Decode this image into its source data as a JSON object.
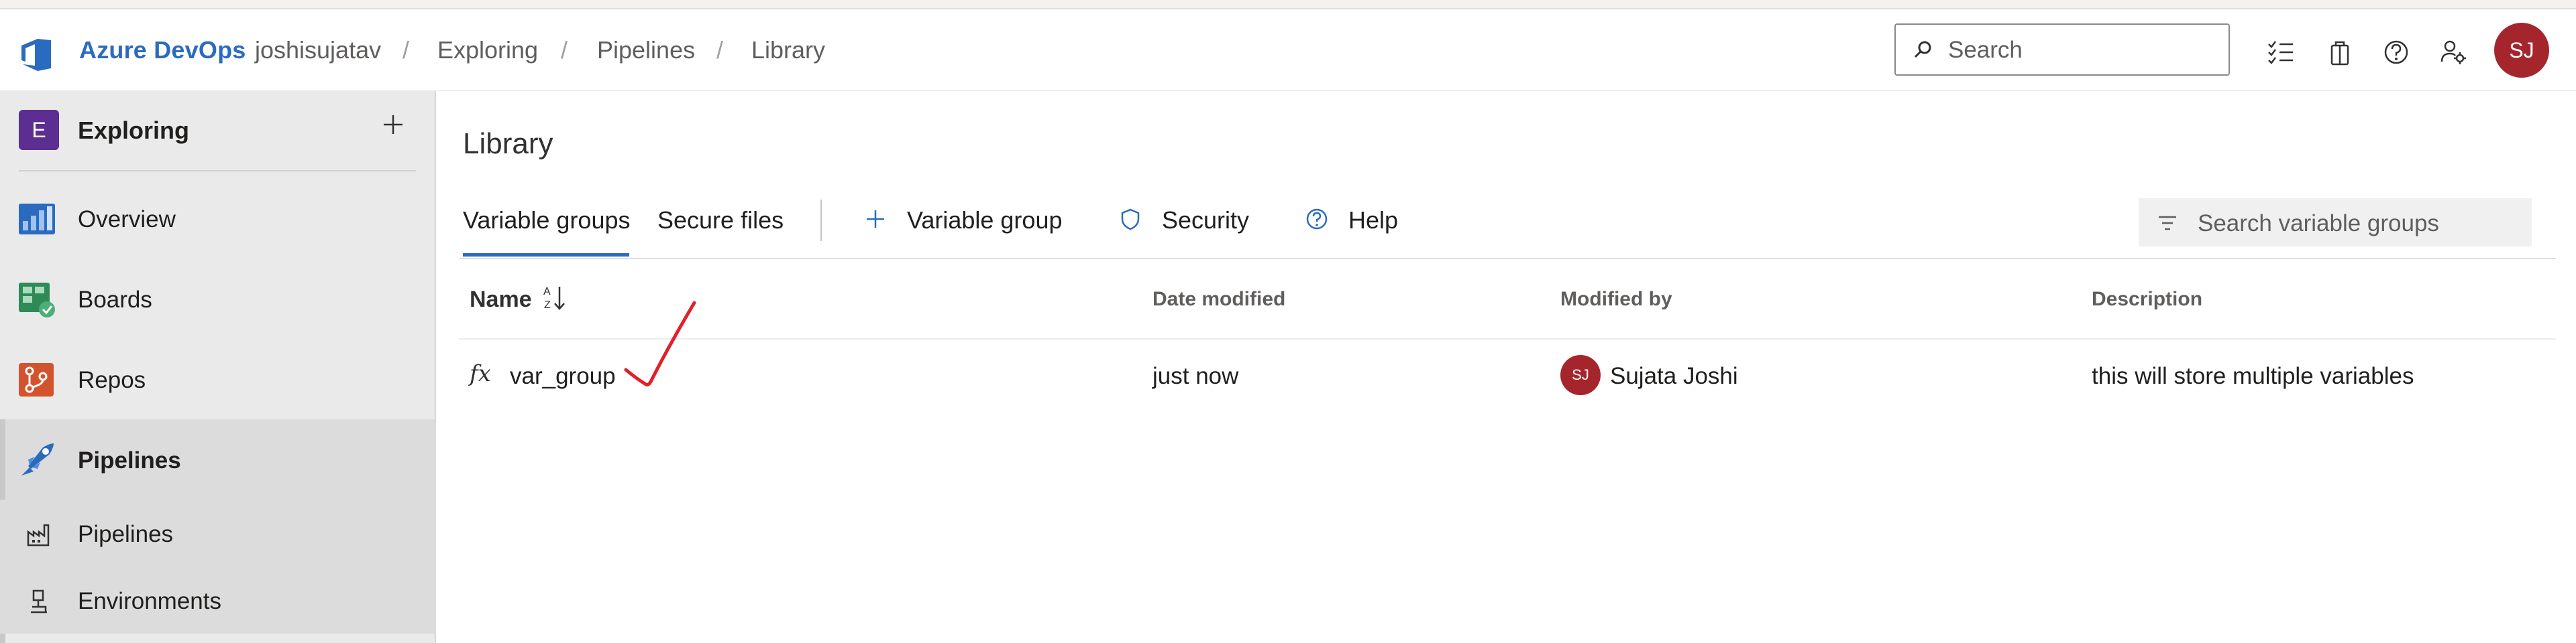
{
  "header": {
    "brand": "Azure DevOps",
    "breadcrumb": [
      "joshisujatav",
      "Exploring",
      "Pipelines",
      "Library"
    ],
    "separator": "/",
    "search_placeholder": "Search",
    "icons": [
      "checklist-icon",
      "shopping-bag-icon",
      "help-icon",
      "user-settings-icon"
    ],
    "avatar_initials": "SJ"
  },
  "sidebar": {
    "project_initial": "E",
    "project_name": "Exploring",
    "items": [
      {
        "label": "Overview",
        "icon": "overview-icon"
      },
      {
        "label": "Boards",
        "icon": "boards-icon"
      },
      {
        "label": "Repos",
        "icon": "repos-icon"
      },
      {
        "label": "Pipelines",
        "icon": "pipelines-icon"
      }
    ],
    "sub_items": [
      {
        "label": "Pipelines",
        "icon": "pipelines-sub-icon"
      },
      {
        "label": "Environments",
        "icon": "environments-icon"
      }
    ]
  },
  "main": {
    "title": "Library",
    "tabs": [
      {
        "label": "Variable groups",
        "active": true
      },
      {
        "label": "Secure files",
        "active": false
      }
    ],
    "commands": {
      "add_label": "Variable group",
      "security_label": "Security",
      "help_label": "Help"
    },
    "filter_placeholder": "Search variable groups",
    "table": {
      "columns": [
        "Name",
        "Date modified",
        "Modified by",
        "Description"
      ],
      "rows": [
        {
          "icon": "fx",
          "name": "var_group",
          "date_modified": "just now",
          "modified_by_initials": "SJ",
          "modified_by": "Sujata Joshi",
          "description": "this will store multiple variables"
        }
      ]
    }
  },
  "colors": {
    "accent": "#2b6bbf",
    "avatar": "#a4262c",
    "project_badge": "#5c2e91",
    "annotation": "#e0202a"
  }
}
